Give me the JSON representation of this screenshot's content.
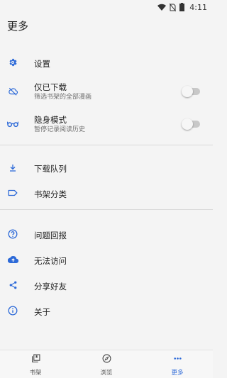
{
  "status_bar": {
    "time": "4:11"
  },
  "header": {
    "title": "更多"
  },
  "menu": {
    "settings": {
      "label": "设置",
      "icon": "gear-icon"
    },
    "offline": {
      "label": "仅已下载",
      "sub": "筛选书架的全部漫画",
      "icon": "cloud-off-icon",
      "enabled": false
    },
    "incognito": {
      "label": "隐身模式",
      "sub": "暂停记录阅读历史",
      "icon": "glasses-icon",
      "enabled": false
    },
    "download_queue": {
      "label": "下载队列",
      "icon": "download-icon"
    },
    "categories": {
      "label": "书架分类",
      "icon": "label-icon"
    },
    "feedback": {
      "label": "问题回报",
      "icon": "help-circle-icon"
    },
    "access": {
      "label": "无法访问",
      "icon": "cloud-upload-icon"
    },
    "share": {
      "label": "分享好友",
      "icon": "share-icon"
    },
    "about": {
      "label": "关于",
      "icon": "info-icon"
    }
  },
  "bottom_nav": {
    "items": [
      {
        "label": "书架",
        "icon": "library-icon",
        "active": false
      },
      {
        "label": "浏览",
        "icon": "compass-icon",
        "active": false
      },
      {
        "label": "更多",
        "icon": "more-horiz-icon",
        "active": true
      }
    ]
  },
  "colors": {
    "accent": "#2d6ad8",
    "background": "#f4f4f4"
  }
}
